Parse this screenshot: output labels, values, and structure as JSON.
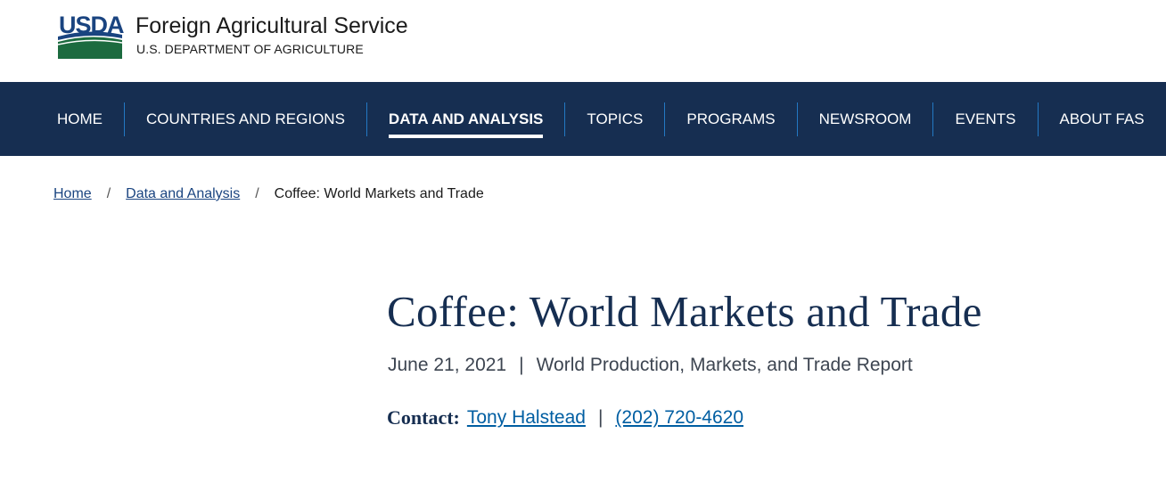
{
  "header": {
    "logo_text": "USDA",
    "title": "Foreign Agricultural Service",
    "subtitle": "U.S. DEPARTMENT OF AGRICULTURE",
    "colors": {
      "logo_blue": "#1a4480",
      "logo_green": "#1c6b3f"
    }
  },
  "nav": {
    "background": "#162e51",
    "items": [
      {
        "label": "HOME",
        "active": false
      },
      {
        "label": "COUNTRIES AND REGIONS",
        "active": false
      },
      {
        "label": "DATA AND ANALYSIS",
        "active": true
      },
      {
        "label": "TOPICS",
        "active": false
      },
      {
        "label": "PROGRAMS",
        "active": false
      },
      {
        "label": "NEWSROOM",
        "active": false
      },
      {
        "label": "EVENTS",
        "active": false
      },
      {
        "label": "ABOUT FAS",
        "active": false
      }
    ]
  },
  "breadcrumb": {
    "items": [
      {
        "label": "Home"
      },
      {
        "label": "Data and Analysis"
      }
    ],
    "separator": "/",
    "current": "Coffee: World Markets and Trade"
  },
  "main": {
    "title": "Coffee: World Markets and Trade",
    "date": "June 21, 2021",
    "meta_separator": "|",
    "report_type": "World Production, Markets, and Trade Report",
    "contact": {
      "label": "Contact:",
      "name": "Tony Halstead",
      "separator": "|",
      "phone": "(202) 720-4620"
    }
  }
}
